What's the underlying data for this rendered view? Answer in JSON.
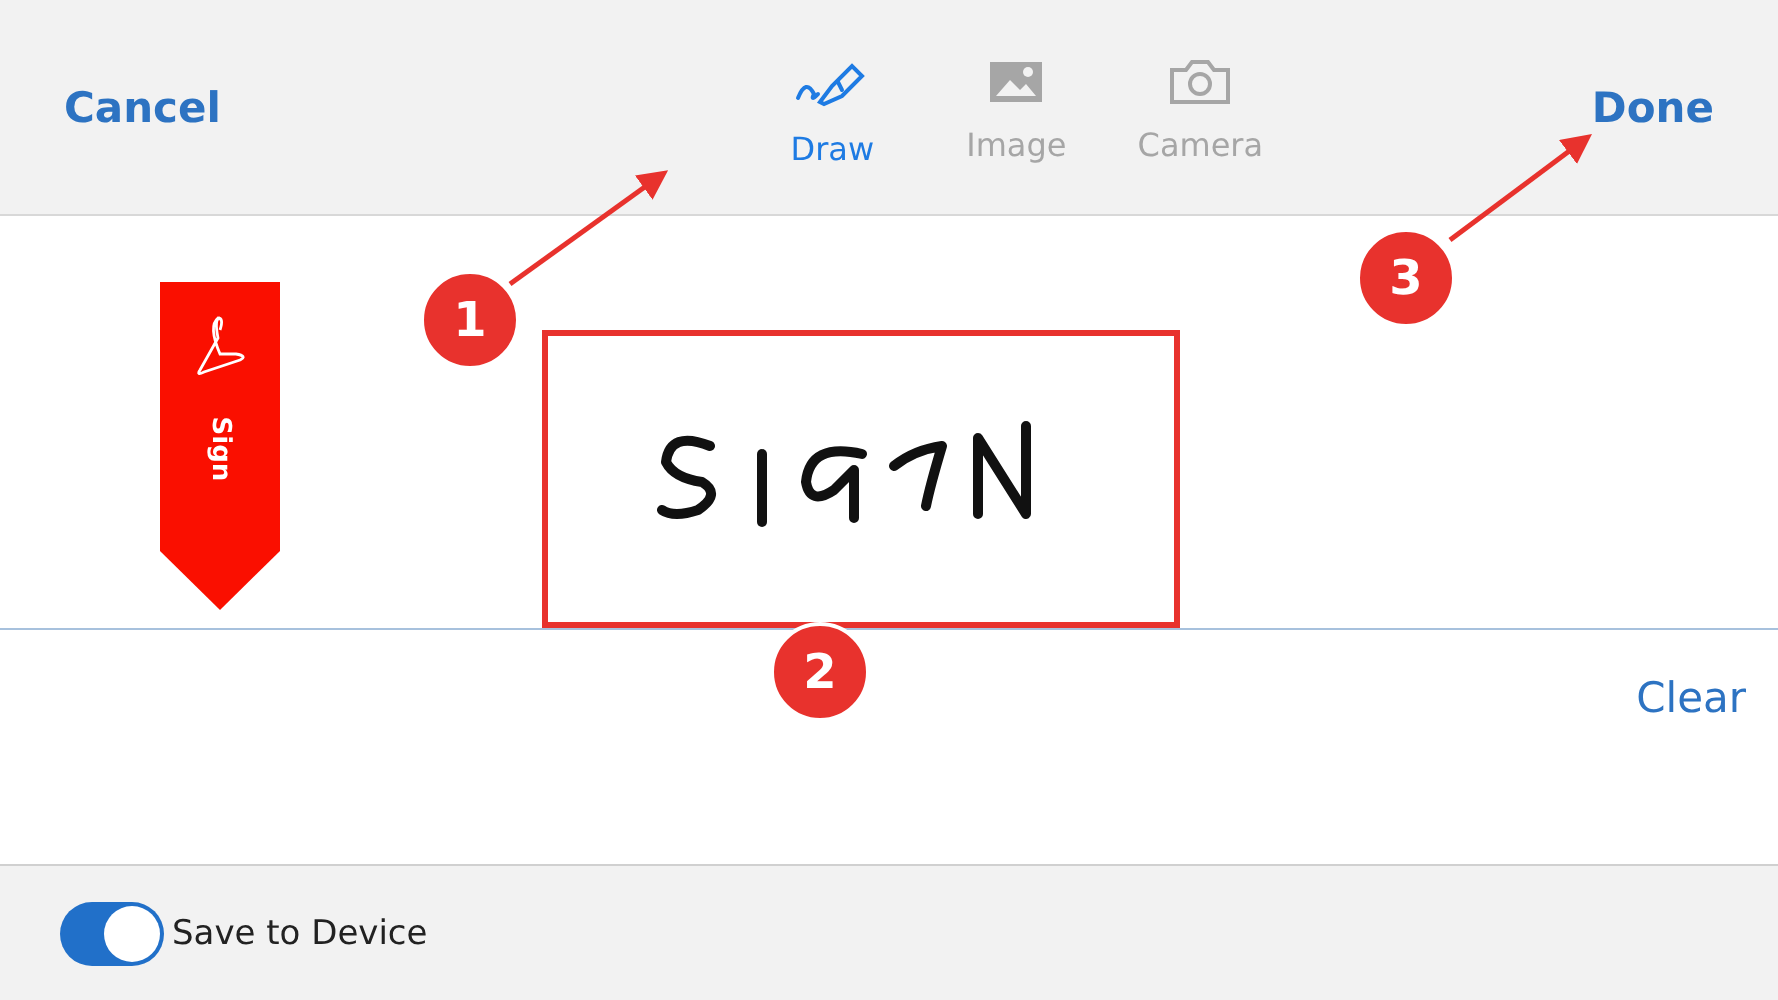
{
  "header": {
    "cancel": "Cancel",
    "done": "Done",
    "tabs": [
      {
        "label": "Draw",
        "kind": "draw",
        "selected": true
      },
      {
        "label": "Image",
        "kind": "image",
        "selected": false
      },
      {
        "label": "Camera",
        "kind": "camera",
        "selected": false
      }
    ]
  },
  "canvas": {
    "ribbon_label": "Sign",
    "clear": "Clear"
  },
  "footer": {
    "save_toggle": {
      "label": "Save to Device",
      "on": true
    }
  },
  "callouts": [
    {
      "number": "1"
    },
    {
      "number": "2"
    },
    {
      "number": "3"
    }
  ]
}
